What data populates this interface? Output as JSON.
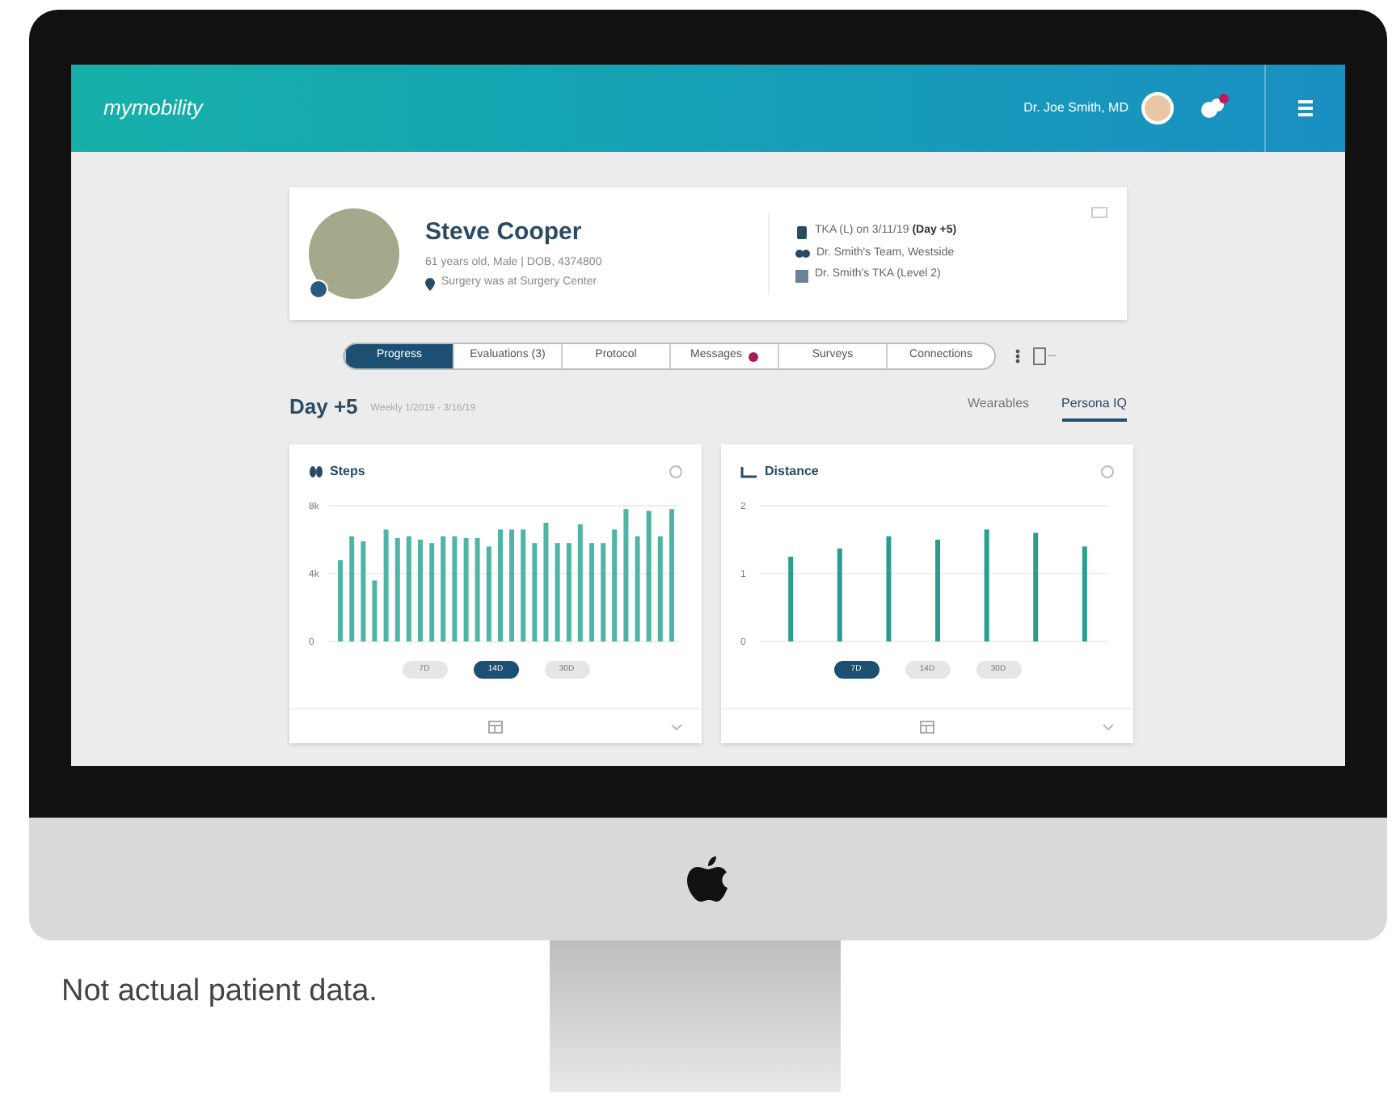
{
  "header": {
    "logo": "mymobility",
    "user": "Dr. Joe Smith, MD",
    "notification_badge": true
  },
  "patient": {
    "name": "Steve Cooper",
    "details": "61 years old, Male | DOB, 4374800",
    "location": "Surgery was at Surgery Center",
    "info": [
      {
        "kind": "procedure",
        "text": "TKA (L) on 3/11/19 ",
        "bold": "(Day +5)"
      },
      {
        "kind": "team",
        "text": "Dr. Smith's Team, Westside"
      },
      {
        "kind": "protocol",
        "text": "Dr. Smith's TKA (Level 2)"
      }
    ]
  },
  "tabs": [
    {
      "label": "Progress",
      "selected": true,
      "alert": false
    },
    {
      "label": "Evaluations (3)",
      "selected": false,
      "alert": false
    },
    {
      "label": "Protocol",
      "selected": false,
      "alert": false
    },
    {
      "label": "Messages",
      "selected": false,
      "alert": true
    },
    {
      "label": "Surveys",
      "selected": false,
      "alert": false
    },
    {
      "label": "Connections",
      "selected": false,
      "alert": false
    }
  ],
  "day": {
    "title": "Day +5",
    "range": "Weekly 1/2019 - 3/16/19"
  },
  "views": [
    {
      "label": "Wearables",
      "selected": false
    },
    {
      "label": "Persona IQ",
      "selected": true
    }
  ],
  "cards": [
    {
      "kind": "steps",
      "title": "Steps",
      "chart_data": {
        "type": "bar",
        "values": [
          4800,
          6200,
          5900,
          3600,
          6600,
          6100,
          6200,
          6000,
          5800,
          6200,
          6200,
          6100,
          6100,
          5600,
          6600,
          6600,
          6600,
          5800,
          7000,
          5800,
          5800,
          6900,
          5800,
          5800,
          6600,
          7800,
          6200,
          7700,
          6200,
          7800
        ],
        "ylim": [
          0,
          8000
        ],
        "yticks": [
          {
            "value": 0,
            "label": "0"
          },
          {
            "value": 4000,
            "label": "4k"
          },
          {
            "value": 8000,
            "label": "8k"
          }
        ]
      },
      "ranges": [
        {
          "label": "7D",
          "selected": false
        },
        {
          "label": "14D",
          "selected": true
        },
        {
          "label": "30D",
          "selected": false
        }
      ]
    },
    {
      "kind": "distance",
      "title": "Distance",
      "chart_data": {
        "type": "bar",
        "values": [
          1.25,
          1.37,
          1.55,
          1.5,
          1.65,
          1.6,
          1.4
        ],
        "ylim": [
          0,
          2
        ],
        "yticks": [
          0,
          1,
          2
        ]
      },
      "ranges": [
        {
          "label": "7D",
          "selected": true
        },
        {
          "label": "14D",
          "selected": false
        },
        {
          "label": "30D",
          "selected": false
        }
      ]
    }
  ],
  "caption": "Not actual patient data."
}
